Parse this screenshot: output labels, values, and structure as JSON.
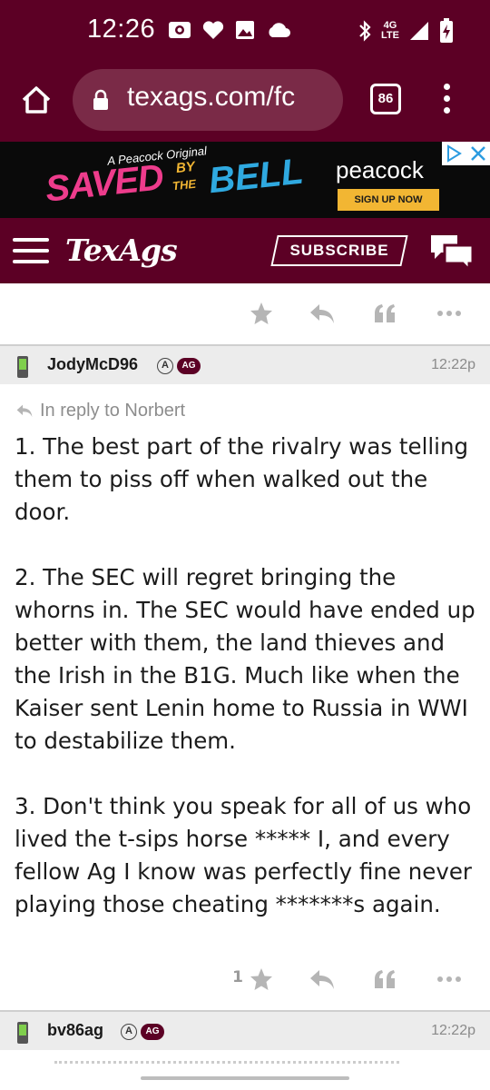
{
  "status_bar": {
    "time": "12:26",
    "network": "4G LTE",
    "network_top": "4G",
    "network_bottom": "LTE"
  },
  "browser": {
    "url": "texags.com/fc",
    "tab_count": "86"
  },
  "ad": {
    "tagline": "A Peacock Original",
    "title_saved": "SAVED",
    "title_by": "BY",
    "title_the": "THE",
    "title_bell": "BELL",
    "brand": "peacock",
    "cta": "SIGN UP NOW"
  },
  "site": {
    "logo": "TexAgs",
    "subscribe_label": "SUBSCRIBE"
  },
  "posts": [
    {
      "author": "JodyMcD96",
      "badge_a": "A",
      "badge_ag": "AG",
      "time": "12:22p",
      "in_reply_to": "In reply to Norbert",
      "paragraphs": [
        "1. The best part of the rivalry was telling them to piss off when walked out the door.",
        "2. The SEC will regret bringing the whorns in. The SEC would have ended up better with them, the land thieves and the Irish in the B1G. Much like when the Kaiser sent Lenin home to Russia in WWI to destabilize them.",
        "3. Don't think you speak for all of us who lived the t-sips horse ***** I, and every fellow Ag I know was perfectly fine never playing those cheating *******s again."
      ],
      "star_count": "1"
    },
    {
      "author": "bv86ag",
      "badge_a": "A",
      "badge_ag": "AG",
      "time": "12:22p"
    }
  ],
  "colors": {
    "maroon": "#5c0025",
    "icon_gray": "#b5b5b5"
  }
}
